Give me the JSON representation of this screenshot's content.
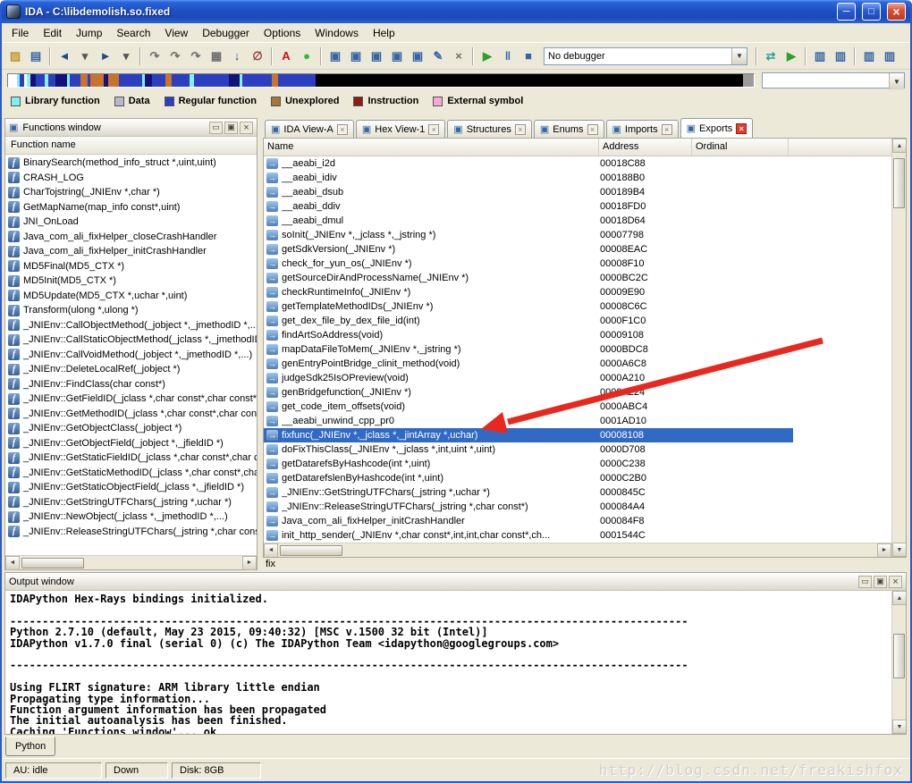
{
  "window": {
    "title": "IDA - C:\\libdemolish.so.fixed",
    "controls": {
      "minimize": "minimize",
      "maximize": "maximize",
      "close": "close"
    }
  },
  "menu": {
    "items": [
      "File",
      "Edit",
      "Jump",
      "Search",
      "View",
      "Debugger",
      "Options",
      "Windows",
      "Help"
    ]
  },
  "toolbar": {
    "debugger_select": "No debugger",
    "items": [
      {
        "t": "icon",
        "n": "open-file-icon",
        "g": "▨",
        "c": "#c79428"
      },
      {
        "t": "icon",
        "n": "save-icon",
        "g": "▤",
        "c": "#3465a4"
      },
      {
        "t": "sep"
      },
      {
        "t": "icon",
        "n": "navigate-back-icon",
        "g": "◄",
        "c": "#204a87"
      },
      {
        "t": "icon",
        "n": "navigate-back-history-icon",
        "g": "▾",
        "c": "#555555"
      },
      {
        "t": "icon",
        "n": "navigate-forward-icon",
        "g": "►",
        "c": "#204a87"
      },
      {
        "t": "icon",
        "n": "navigate-forward-history-icon",
        "g": "▾",
        "c": "#555555"
      },
      {
        "t": "sep"
      },
      {
        "t": "icon",
        "n": "jump-function-icon",
        "g": "↷",
        "c": "#6e6e6e"
      },
      {
        "t": "icon",
        "n": "jump-segment-icon",
        "g": "↷",
        "c": "#6e6e6e"
      },
      {
        "t": "icon",
        "n": "jump-name-icon",
        "g": "↷",
        "c": "#6e6e6e"
      },
      {
        "t": "icon",
        "n": "produce-file-icon",
        "g": "▦",
        "c": "#6e6e6e"
      },
      {
        "t": "icon",
        "n": "jump-address-icon",
        "g": "↓",
        "c": "#204a87"
      },
      {
        "t": "icon",
        "n": "cancel-icon",
        "g": "∅",
        "c": "#9a3b3b"
      },
      {
        "t": "sep"
      },
      {
        "t": "icon",
        "n": "text-search-icon",
        "g": "A",
        "c": "#cc1111"
      },
      {
        "t": "icon",
        "n": "analysis-indicator-icon",
        "g": "●",
        "c": "#2ebb2e"
      },
      {
        "t": "sep"
      },
      {
        "t": "icon",
        "n": "breakpoint-list-icon",
        "g": "▣",
        "c": "#3465a4"
      },
      {
        "t": "icon",
        "n": "add-breakpoint-icon",
        "g": "▣",
        "c": "#3465a4"
      },
      {
        "t": "icon",
        "n": "step-into-icon",
        "g": "▣",
        "c": "#3465a4"
      },
      {
        "t": "icon",
        "n": "step-over-icon",
        "g": "▣",
        "c": "#3465a4"
      },
      {
        "t": "icon",
        "n": "run-until-return-icon",
        "g": "▣",
        "c": "#3465a4"
      },
      {
        "t": "icon",
        "n": "edit-icon",
        "g": "✎",
        "c": "#3465a4"
      },
      {
        "t": "icon",
        "n": "delete-icon",
        "g": "×",
        "c": "#6e6e6e"
      },
      {
        "t": "sep"
      },
      {
        "t": "icon",
        "n": "start-process-icon",
        "g": "▶",
        "c": "#2e9e2e"
      },
      {
        "t": "icon",
        "n": "pause-process-icon",
        "g": "‖",
        "c": "#3465a4"
      },
      {
        "t": "icon",
        "n": "stop-process-icon",
        "g": "■",
        "c": "#3465a4"
      },
      {
        "t": "combo"
      },
      {
        "t": "sep"
      },
      {
        "t": "icon",
        "n": "debugger-setup-icon",
        "g": "⇄",
        "c": "#2aa198"
      },
      {
        "t": "icon",
        "n": "attach-process-icon",
        "g": "▶",
        "c": "#2e9e2e"
      },
      {
        "t": "sep"
      },
      {
        "t": "icon",
        "n": "desktop-window-icon",
        "g": "▥",
        "c": "#3465a4"
      },
      {
        "t": "icon",
        "n": "desktop-window-2-icon",
        "g": "▥",
        "c": "#3465a4"
      },
      {
        "t": "sep"
      },
      {
        "t": "icon",
        "n": "window-add-icon",
        "g": "▥",
        "c": "#3465a4"
      },
      {
        "t": "icon",
        "n": "window-list-icon",
        "g": "▥",
        "c": "#3465a4"
      }
    ]
  },
  "nav_band": {
    "segments": [
      [
        "#ffffff",
        6
      ],
      [
        "#86efef",
        2
      ],
      [
        "#2b3fc0",
        3
      ],
      [
        "#ffffff",
        2
      ],
      [
        "#86efef",
        2
      ],
      [
        "#12127a",
        4
      ],
      [
        "#2b3fc0",
        6
      ],
      [
        "#86efef",
        2
      ],
      [
        "#2b3fc0",
        5
      ],
      [
        "#12127a",
        8
      ],
      [
        "#86efef",
        2
      ],
      [
        "#2b3fc0",
        7
      ],
      [
        "#c9742c",
        5
      ],
      [
        "#2b3fc0",
        2
      ],
      [
        "#c9742c",
        9
      ],
      [
        "#12127a",
        3
      ],
      [
        "#c9742c",
        7
      ],
      [
        "#2b3fc0",
        16
      ],
      [
        "#86efef",
        2
      ],
      [
        "#12127a",
        5
      ],
      [
        "#2b3fc0",
        9
      ],
      [
        "#c9742c",
        4
      ],
      [
        "#2b3fc0",
        12
      ],
      [
        "#86efef",
        3
      ],
      [
        "#2b3fc0",
        24
      ],
      [
        "#12127a",
        7
      ],
      [
        "#86efef",
        2
      ],
      [
        "#2b3fc0",
        20
      ],
      [
        "#c9742c",
        4
      ],
      [
        "#2b3fc0",
        26
      ],
      [
        "#000000",
        290
      ],
      [
        "#9b9b9b",
        7
      ]
    ]
  },
  "legend": {
    "items": [
      {
        "label": "Library function",
        "color": "#7df0f0"
      },
      {
        "label": "Data",
        "color": "#b8b8c8"
      },
      {
        "label": "Regular function",
        "color": "#2b3fc0"
      },
      {
        "label": "Unexplored",
        "color": "#a6763c"
      },
      {
        "label": "Instruction",
        "color": "#8c1d12"
      },
      {
        "label": "External symbol",
        "color": "#f5a9d4"
      }
    ]
  },
  "functions_window": {
    "title": "Functions window",
    "header": "Function name",
    "items": [
      "BinarySearch(method_info_struct *,uint,uint)",
      "CRASH_LOG",
      "CharTojstring(_JNIEnv *,char *)",
      "GetMapName(map_info const*,uint)",
      "JNI_OnLoad",
      "Java_com_ali_fixHelper_closeCrashHandler",
      "Java_com_ali_fixHelper_initCrashHandler",
      "MD5Final(MD5_CTX *)",
      "MD5Init(MD5_CTX *)",
      "MD5Update(MD5_CTX *,uchar *,uint)",
      "Transform(ulong *,ulong *)",
      "_JNIEnv::CallObjectMethod(_jobject *,_jmethodID *,...)",
      "_JNIEnv::CallStaticObjectMethod(_jclass *,_jmethodID *,...)",
      "_JNIEnv::CallVoidMethod(_jobject *,_jmethodID *,...)",
      "_JNIEnv::DeleteLocalRef(_jobject *)",
      "_JNIEnv::FindClass(char const*)",
      "_JNIEnv::GetFieldID(_jclass *,char const*,char const*)",
      "_JNIEnv::GetMethodID(_jclass *,char const*,char const*)",
      "_JNIEnv::GetObjectClass(_jobject *)",
      "_JNIEnv::GetObjectField(_jobject *,_jfieldID *)",
      "_JNIEnv::GetStaticFieldID(_jclass *,char const*,char const*)",
      "_JNIEnv::GetStaticMethodID(_jclass *,char const*,char const*)",
      "_JNIEnv::GetStaticObjectField(_jclass *,_jfieldID *)",
      "_JNIEnv::GetStringUTFChars(_jstring *,uchar *)",
      "_JNIEnv::NewObject(_jclass *,_jmethodID *,...)",
      "_JNIEnv::ReleaseStringUTFChars(_jstring *,char const*)"
    ]
  },
  "view_tabs": [
    {
      "label": "IDA View-A",
      "active": false
    },
    {
      "label": "Hex View-1",
      "active": false
    },
    {
      "label": "Structures",
      "active": false
    },
    {
      "label": "Enums",
      "active": false
    },
    {
      "label": "Imports",
      "active": false
    },
    {
      "label": "Exports",
      "active": true
    }
  ],
  "exports": {
    "columns": [
      "Name",
      "Address",
      "Ordinal"
    ],
    "selected_index": 19,
    "status": "fix",
    "rows": [
      {
        "name": "__aeabi_i2d",
        "address": "00018C88",
        "ordinal": ""
      },
      {
        "name": "__aeabi_idiv",
        "address": "000188B0",
        "ordinal": ""
      },
      {
        "name": "__aeabi_dsub",
        "address": "000189B4",
        "ordinal": ""
      },
      {
        "name": "__aeabi_ddiv",
        "address": "00018FD0",
        "ordinal": ""
      },
      {
        "name": "__aeabi_dmul",
        "address": "00018D64",
        "ordinal": ""
      },
      {
        "name": "soInit(_JNIEnv *,_jclass *,_jstring *)",
        "address": "00007798",
        "ordinal": ""
      },
      {
        "name": "getSdkVersion(_JNIEnv *)",
        "address": "00008EAC",
        "ordinal": ""
      },
      {
        "name": "check_for_yun_os(_JNIEnv *)",
        "address": "00008F10",
        "ordinal": ""
      },
      {
        "name": "getSourceDirAndProcessName(_JNIEnv *)",
        "address": "0000BC2C",
        "ordinal": ""
      },
      {
        "name": "checkRuntimeInfo(_JNIEnv *)",
        "address": "00009E90",
        "ordinal": ""
      },
      {
        "name": "getTemplateMethodIDs(_JNIEnv *)",
        "address": "00008C6C",
        "ordinal": ""
      },
      {
        "name": "get_dex_file_by_dex_file_id(int)",
        "address": "0000F1C0",
        "ordinal": ""
      },
      {
        "name": "findArtSoAddress(void)",
        "address": "00009108",
        "ordinal": ""
      },
      {
        "name": "mapDataFileToMem(_JNIEnv *,_jstring *)",
        "address": "0000BDC8",
        "ordinal": ""
      },
      {
        "name": "genEntryPointBridge_clinit_method(void)",
        "address": "0000A6C8",
        "ordinal": ""
      },
      {
        "name": "judgeSdk25IsOPreview(void)",
        "address": "0000A210",
        "ordinal": ""
      },
      {
        "name": "genBridgefunction(_JNIEnv *)",
        "address": "0000A224",
        "ordinal": ""
      },
      {
        "name": "get_code_item_offsets(void)",
        "address": "0000ABC4",
        "ordinal": ""
      },
      {
        "name": "__aeabi_unwind_cpp_pr0",
        "address": "0001AD10",
        "ordinal": ""
      },
      {
        "name": "fixfunc(_JNIEnv *,_jclass *,_jintArray *,uchar)",
        "address": "00008108",
        "ordinal": ""
      },
      {
        "name": "doFixThisClass(_JNIEnv *,_jclass *,int,uint *,uint)",
        "address": "0000D708",
        "ordinal": ""
      },
      {
        "name": "getDatarefsByHashcode(int *,uint)",
        "address": "0000C238",
        "ordinal": ""
      },
      {
        "name": "getDatarefslenByHashcode(int *,uint)",
        "address": "0000C2B0",
        "ordinal": ""
      },
      {
        "name": "_JNIEnv::GetStringUTFChars(_jstring *,uchar *)",
        "address": "0000845C",
        "ordinal": ""
      },
      {
        "name": "_JNIEnv::ReleaseStringUTFChars(_jstring *,char const*)",
        "address": "000084A4",
        "ordinal": ""
      },
      {
        "name": "Java_com_ali_fixHelper_initCrashHandler",
        "address": "000084F8",
        "ordinal": ""
      },
      {
        "name": "init_http_sender(_JNIEnv *,char const*,int,int,char const*,ch...",
        "address": "0001544C",
        "ordinal": ""
      }
    ]
  },
  "output_window": {
    "title": "Output window",
    "tab_label": "Python",
    "lines": [
      "IDAPython Hex-Rays bindings initialized.",
      "",
      "---------------------------------------------------------------------------------------------------------",
      "Python 2.7.10 (default, May 23 2015, 09:40:32) [MSC v.1500 32 bit (Intel)]",
      "IDAPython v1.7.0 final (serial 0) (c) The IDAPython Team <idapython@googlegroups.com>",
      "",
      "---------------------------------------------------------------------------------------------------------",
      "",
      "Using FLIRT signature: ARM library little endian",
      "Propagating type information...",
      "Function argument information has been propagated",
      "The initial autoanalysis has been finished.",
      "Caching 'Functions window'... ok"
    ]
  },
  "status_bar": {
    "au": "AU: idle",
    "mode": "Down",
    "disk": "Disk: 8GB",
    "watermark": "http://blog.csdn.net/freakishfox"
  },
  "annotation": {
    "arrow_color": "#e8281e"
  }
}
